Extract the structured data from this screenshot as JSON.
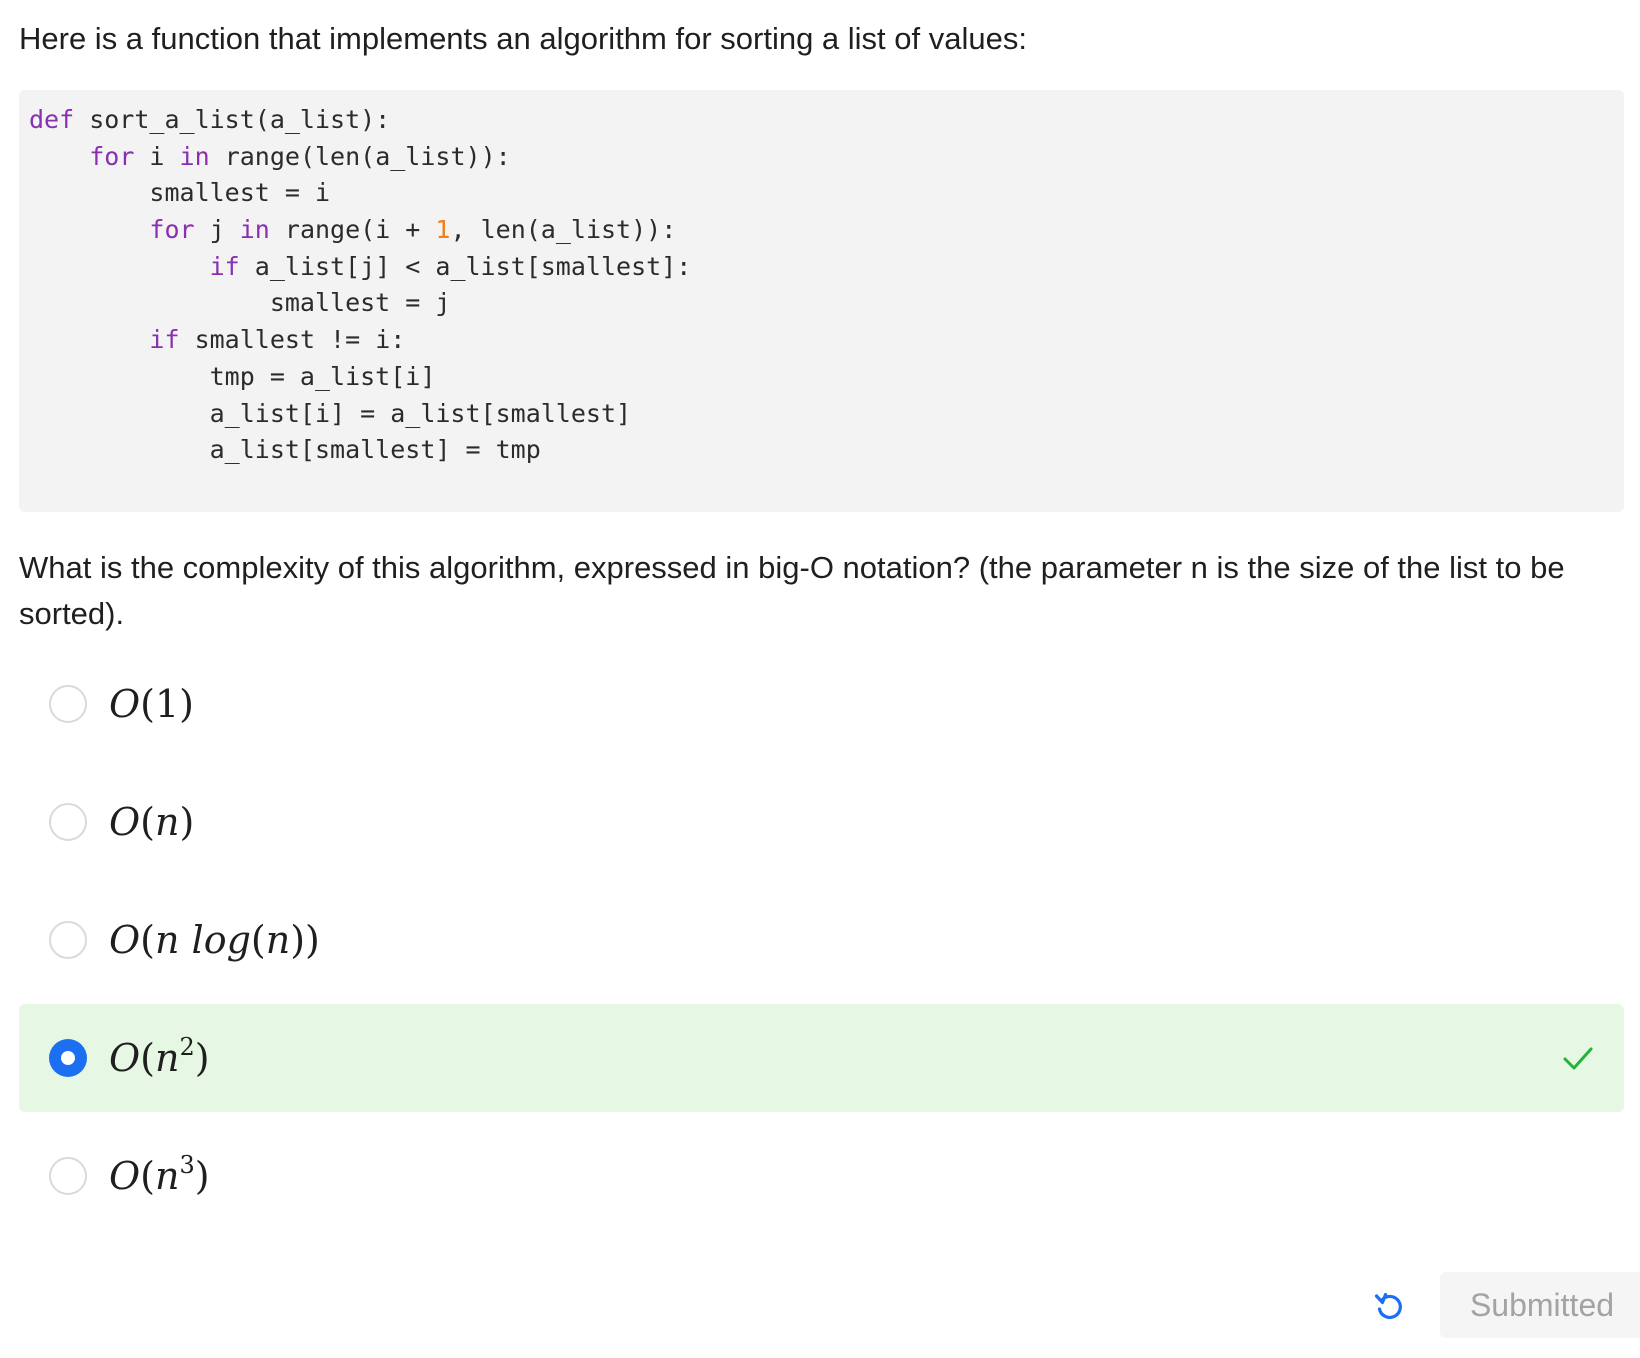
{
  "intro_text": "Here is a function that implements an algorithm for sorting a list of values:",
  "code": {
    "language": "python",
    "lines": [
      "def sort_a_list(a_list):",
      "    for i in range(len(a_list)):",
      "        smallest = i",
      "        for j in range(i + 1, len(a_list)):",
      "            if a_list[j] < a_list[smallest]:",
      "                smallest = j",
      "        if smallest != i:",
      "            tmp = a_list[i]",
      "            a_list[i] = a_list[smallest]",
      "            a_list[smallest] = tmp"
    ]
  },
  "question_text": "What is the complexity of this algorithm, expressed in big-O notation? (the parameter n is the size of the list to be sorted).",
  "options": [
    {
      "id": "o1",
      "label": "O(1)",
      "selected": false
    },
    {
      "id": "on",
      "label": "O(n)",
      "selected": false
    },
    {
      "id": "onlogn",
      "label": "O(n log(n))",
      "selected": false
    },
    {
      "id": "on2",
      "label": "O(n^2)",
      "selected": true,
      "correct": true
    },
    {
      "id": "on3",
      "label": "O(n^3)",
      "selected": false
    }
  ],
  "actions": {
    "reset_icon": "reset-icon",
    "submit_label": "Submitted"
  },
  "colors": {
    "keyword": "#8a2fb0",
    "number": "#f07f16",
    "selected_bg": "#e6f8e4",
    "radio_checked": "#1b6ff0",
    "check": "#22b33a",
    "reset_icon": "#1b6ff0"
  }
}
